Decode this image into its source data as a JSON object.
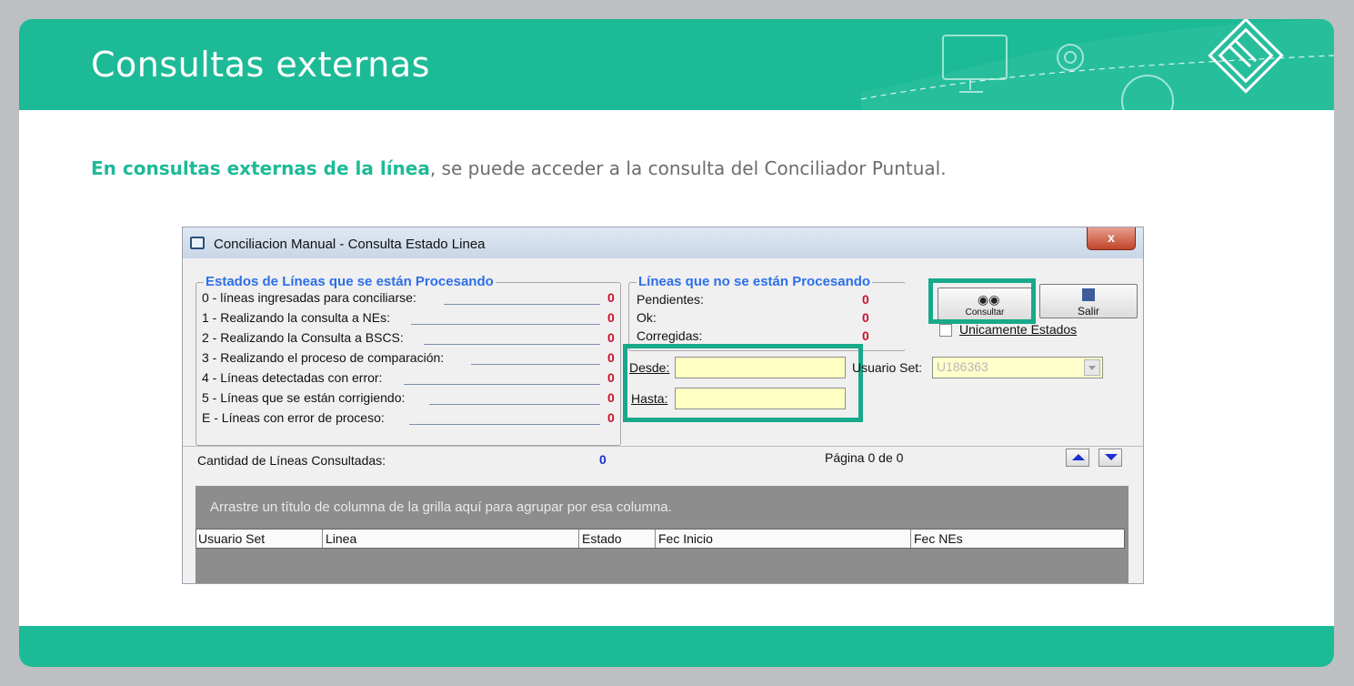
{
  "slide": {
    "title": "Consultas externas",
    "intro_highlight": "En consultas externas de la línea",
    "intro_rest": ", se puede acceder a la consulta del Conciliador Puntual."
  },
  "window": {
    "title": "Conciliacion Manual - Consulta Estado Linea",
    "close_label": "x",
    "group_processing": {
      "legend": "Estados de Líneas que se están Procesando",
      "items": [
        {
          "label": "0 - líneas ingresadas para conciliarse:",
          "value": "0"
        },
        {
          "label": "1 - Realizando la consulta a NEs:",
          "value": "0"
        },
        {
          "label": "2 - Realizando la Consulta a BSCS:",
          "value": "0"
        },
        {
          "label": "3 - Realizando el proceso de comparación:",
          "value": "0"
        },
        {
          "label": "4 - Líneas detectadas con error:",
          "value": "0"
        },
        {
          "label": "5 - Líneas que se están corrigiendo:",
          "value": "0"
        },
        {
          "label": "E - Líneas con error de proceso:",
          "value": "0"
        }
      ]
    },
    "group_not_processing": {
      "legend": "Líneas que no se están Procesando",
      "items": [
        {
          "label": "Pendientes:",
          "value": "0"
        },
        {
          "label": "Ok:",
          "value": "0"
        },
        {
          "label": "Corregidas:",
          "value": "0"
        }
      ]
    },
    "desde_label": "Desde:",
    "desde_value": "",
    "hasta_label": "Hasta:",
    "hasta_value": "",
    "usuario_set_label": "Usuario Set:",
    "usuario_set_value": "U186363",
    "consultar_label": "Consultar",
    "salir_label": "Salir",
    "unicamente_estados_label": "Unicamente Estados",
    "cantidad_label": "Cantidad de Líneas Consultadas:",
    "cantidad_value": "0",
    "pagina_text": "Página 0 de 0",
    "grid": {
      "group_hint": "Arrastre un título de columna de la grilla aquí para agrupar por esa columna.",
      "columns": [
        "Usuario Set",
        "Linea",
        "Estado",
        "Fec Inicio",
        "Fec NEs"
      ]
    },
    "colors": {
      "highlight": "#17a98a",
      "value_red": "#c8102e",
      "legend_blue": "#2d6fe8"
    }
  }
}
